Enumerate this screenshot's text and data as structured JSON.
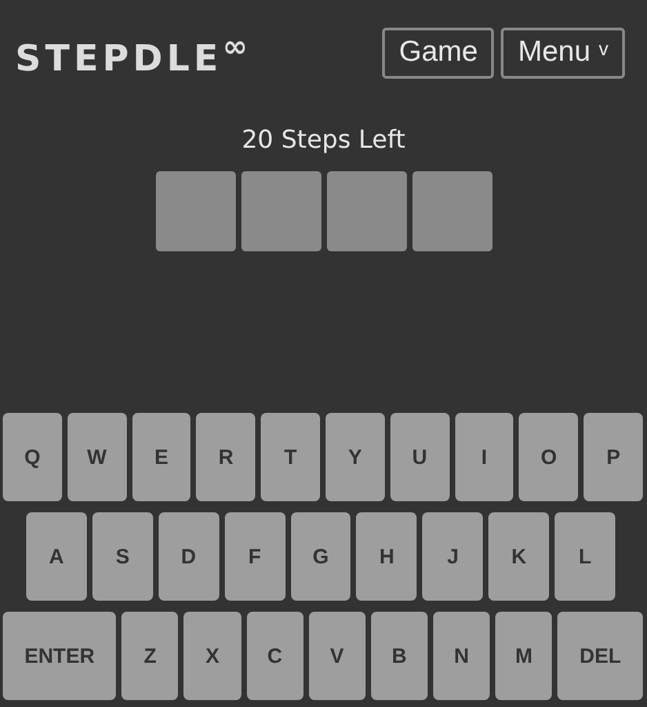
{
  "header": {
    "logo": "STEPDLE$^{∞}$",
    "buttons": [
      {
        "label": "Game"
      },
      {
        "label": "Menu",
        "caret": "v"
      }
    ]
  },
  "steps_left": "20 Steps Left",
  "tiles": [
    {
      "kind": "empty"
    },
    {
      "kind": "empty"
    },
    {
      "kind": "empty"
    },
    {
      "kind": "empty"
    }
  ],
  "keyboard": [
    [
      {
        "label": "Q",
        "kind": "letter"
      },
      {
        "label": "W",
        "kind": "letter"
      },
      {
        "label": "E",
        "kind": "letter"
      },
      {
        "label": "R",
        "kind": "letter"
      },
      {
        "label": "T",
        "kind": "letter"
      },
      {
        "label": "Y",
        "kind": "letter"
      },
      {
        "label": "U",
        "kind": "letter"
      },
      {
        "label": "I",
        "kind": "letter"
      },
      {
        "label": "O",
        "kind": "letter"
      },
      {
        "label": "P",
        "kind": "letter"
      }
    ],
    [
      {
        "label": "A",
        "kind": "letter"
      },
      {
        "label": "S",
        "kind": "letter"
      },
      {
        "label": "D",
        "kind": "letter"
      },
      {
        "label": "F",
        "kind": "letter"
      },
      {
        "label": "G",
        "kind": "letter"
      },
      {
        "label": "H",
        "kind": "letter"
      },
      {
        "label": "J",
        "kind": "letter"
      },
      {
        "label": "K",
        "kind": "letter"
      },
      {
        "label": "L",
        "kind": "letter"
      }
    ],
    [
      {
        "label": "ENTER",
        "kind": "enter"
      },
      {
        "label": "Z",
        "kind": "letter"
      },
      {
        "label": "X",
        "kind": "letter"
      },
      {
        "label": "C",
        "kind": "letter"
      },
      {
        "label": "V",
        "kind": "letter"
      },
      {
        "label": "B",
        "kind": "letter"
      },
      {
        "label": "N",
        "kind": "letter"
      },
      {
        "label": "M",
        "kind": "letter"
      },
      {
        "label": "DEL",
        "kind": "delete"
      }
    ]
  ]
}
